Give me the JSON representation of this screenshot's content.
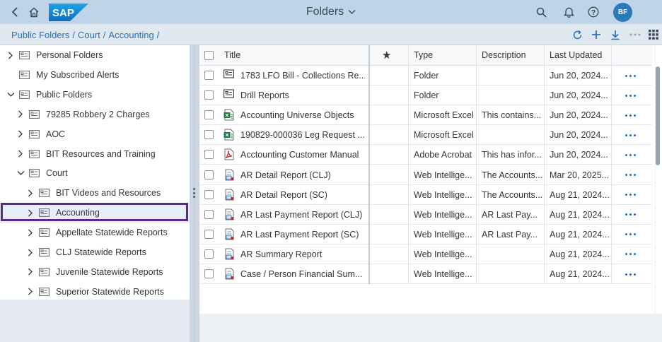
{
  "shell": {
    "title": "Folders",
    "logo_text": "SAP",
    "avatar_initials": "BF"
  },
  "breadcrumb": [
    "Public Folders",
    "Court",
    "Accounting"
  ],
  "tree": [
    {
      "label": "Personal Folders",
      "expanded": false
    },
    {
      "label": "My Subscribed Alerts",
      "expanded": null
    },
    {
      "label": "Public Folders",
      "expanded": true
    },
    {
      "label": "79285 Robbery 2 Charges",
      "expanded": false
    },
    {
      "label": "AOC",
      "expanded": false
    },
    {
      "label": "BIT Resources and Training",
      "expanded": false
    },
    {
      "label": "Court",
      "expanded": true
    },
    {
      "label": "BIT Videos and Resources",
      "expanded": false
    },
    {
      "label": "Accounting",
      "expanded": false,
      "selected": true
    },
    {
      "label": "Appellate Statewide Reports",
      "expanded": false
    },
    {
      "label": "CLJ Statewide Reports",
      "expanded": false
    },
    {
      "label": "Juvenile Statewide Reports",
      "expanded": false
    },
    {
      "label": "Superior Statewide Reports",
      "expanded": false
    }
  ],
  "table": {
    "headers": {
      "title": "Title",
      "favorite": "★",
      "type": "Type",
      "description": "Description",
      "updated": "Last Updated"
    },
    "rows": [
      {
        "icon": "folder",
        "title": "1783 LFO Bill - Collections Re...",
        "type": "Folder",
        "description": "",
        "updated": "Jun 20, 2024..."
      },
      {
        "icon": "folder",
        "title": "Drill Reports",
        "type": "Folder",
        "description": "",
        "updated": "Jun 20, 2024..."
      },
      {
        "icon": "excel",
        "title": "Accounting Universe Objects",
        "type": "Microsoft Excel",
        "description": "This contains...",
        "updated": "Jun 20, 2024..."
      },
      {
        "icon": "excel",
        "title": "190829-000036 Leg Request ...",
        "type": "Microsoft Excel",
        "description": "",
        "updated": "Jun 20, 2024..."
      },
      {
        "icon": "pdf",
        "title": "Acctounting Customer Manual",
        "type": "Adobe Acrobat",
        "description": "This has infor...",
        "updated": "Jun 20, 2024..."
      },
      {
        "icon": "webi",
        "title": "AR Detail Report (CLJ)",
        "type": "Web Intellige...",
        "description": "The Accounts...",
        "updated": "Mar 20, 2025..."
      },
      {
        "icon": "webi",
        "title": "AR Detail Report (SC)",
        "type": "Web Intellige...",
        "description": "The Accounts...",
        "updated": "Aug 21, 2024..."
      },
      {
        "icon": "webi",
        "title": "AR Last Payment Report (CLJ)",
        "type": "Web Intellige...",
        "description": "AR Last Pay...",
        "updated": "Aug 21, 2024..."
      },
      {
        "icon": "webi",
        "title": "AR Last Payment Report (SC)",
        "type": "Web Intellige...",
        "description": "AR Last Pay...",
        "updated": "Aug 21, 2024..."
      },
      {
        "icon": "webi",
        "title": "AR Summary Report",
        "type": "Web Intellige...",
        "description": "",
        "updated": "Aug 21, 2024..."
      },
      {
        "icon": "webi",
        "title": "Case / Person Financial Sum...",
        "type": "Web Intellige...",
        "description": "",
        "updated": "Aug 21, 2024..."
      }
    ]
  },
  "colors": {
    "shell_bg": "#bfd4e8",
    "link": "#2a6ebb",
    "selection_outline": "#5b2a86",
    "avatar": "#2a7ab8"
  }
}
